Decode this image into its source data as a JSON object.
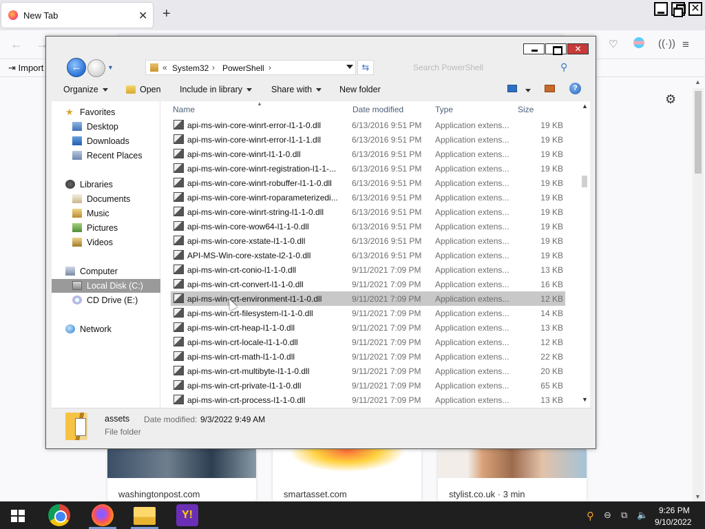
{
  "browser": {
    "tab_title": "New Tab",
    "tab_close": "✕",
    "new_tab": "+",
    "window_close": "✕",
    "import_bookmarks": "Import",
    "settings_icon": "gear-icon",
    "stories": [
      {
        "source": "washingtonpost.com"
      },
      {
        "source": "smartasset.com"
      },
      {
        "source": "stylist.co.uk · 3 min"
      }
    ]
  },
  "explorer": {
    "close_label": "✕",
    "address": {
      "overflow": "«",
      "crumbs": [
        "System32",
        "PowerShell"
      ],
      "separator": "›"
    },
    "search_placeholder": "Search PowerShell",
    "commands": {
      "organize": "Organize",
      "open": "Open",
      "include": "Include in library",
      "share": "Share with",
      "new_folder": "New folder"
    },
    "nav": {
      "favorites": "Favorites",
      "desktop": "Desktop",
      "downloads": "Downloads",
      "recent": "Recent Places",
      "libraries": "Libraries",
      "documents": "Documents",
      "music": "Music",
      "pictures": "Pictures",
      "videos": "Videos",
      "computer": "Computer",
      "local_disk": "Local Disk (C:)",
      "cd_drive": "CD Drive (E:)",
      "network": "Network"
    },
    "columns": {
      "name": "Name",
      "date": "Date modified",
      "type": "Type",
      "size": "Size"
    },
    "files": [
      {
        "name": "api-ms-win-core-winrt-error-l1-1-0.dll",
        "date": "6/13/2016 9:51 PM",
        "type": "Application extens...",
        "size": "19 KB"
      },
      {
        "name": "api-ms-win-core-winrt-error-l1-1-1.dll",
        "date": "6/13/2016 9:51 PM",
        "type": "Application extens...",
        "size": "19 KB"
      },
      {
        "name": "api-ms-win-core-winrt-l1-1-0.dll",
        "date": "6/13/2016 9:51 PM",
        "type": "Application extens...",
        "size": "19 KB"
      },
      {
        "name": "api-ms-win-core-winrt-registration-l1-1-...",
        "date": "6/13/2016 9:51 PM",
        "type": "Application extens...",
        "size": "19 KB"
      },
      {
        "name": "api-ms-win-core-winrt-robuffer-l1-1-0.dll",
        "date": "6/13/2016 9:51 PM",
        "type": "Application extens...",
        "size": "19 KB"
      },
      {
        "name": "api-ms-win-core-winrt-roparameterizedi...",
        "date": "6/13/2016 9:51 PM",
        "type": "Application extens...",
        "size": "19 KB"
      },
      {
        "name": "api-ms-win-core-winrt-string-l1-1-0.dll",
        "date": "6/13/2016 9:51 PM",
        "type": "Application extens...",
        "size": "19 KB"
      },
      {
        "name": "api-ms-win-core-wow64-l1-1-0.dll",
        "date": "6/13/2016 9:51 PM",
        "type": "Application extens...",
        "size": "19 KB"
      },
      {
        "name": "api-ms-win-core-xstate-l1-1-0.dll",
        "date": "6/13/2016 9:51 PM",
        "type": "Application extens...",
        "size": "19 KB"
      },
      {
        "name": "API-MS-Win-core-xstate-l2-1-0.dll",
        "date": "6/13/2016 9:51 PM",
        "type": "Application extens...",
        "size": "19 KB"
      },
      {
        "name": "api-ms-win-crt-conio-l1-1-0.dll",
        "date": "9/11/2021 7:09 PM",
        "type": "Application extens...",
        "size": "13 KB"
      },
      {
        "name": "api-ms-win-crt-convert-l1-1-0.dll",
        "date": "9/11/2021 7:09 PM",
        "type": "Application extens...",
        "size": "16 KB"
      },
      {
        "name": "api-ms-win-crt-environment-l1-1-0.dll",
        "date": "9/11/2021 7:09 PM",
        "type": "Application extens...",
        "size": "12 KB"
      },
      {
        "name": "api-ms-win-crt-filesystem-l1-1-0.dll",
        "date": "9/11/2021 7:09 PM",
        "type": "Application extens...",
        "size": "14 KB"
      },
      {
        "name": "api-ms-win-crt-heap-l1-1-0.dll",
        "date": "9/11/2021 7:09 PM",
        "type": "Application extens...",
        "size": "13 KB"
      },
      {
        "name": "api-ms-win-crt-locale-l1-1-0.dll",
        "date": "9/11/2021 7:09 PM",
        "type": "Application extens...",
        "size": "12 KB"
      },
      {
        "name": "api-ms-win-crt-math-l1-1-0.dll",
        "date": "9/11/2021 7:09 PM",
        "type": "Application extens...",
        "size": "22 KB"
      },
      {
        "name": "api-ms-win-crt-multibyte-l1-1-0.dll",
        "date": "9/11/2021 7:09 PM",
        "type": "Application extens...",
        "size": "20 KB"
      },
      {
        "name": "api-ms-win-crt-private-l1-1-0.dll",
        "date": "9/11/2021 7:09 PM",
        "type": "Application extens...",
        "size": "65 KB"
      },
      {
        "name": "api-ms-win-crt-process-l1-1-0.dll",
        "date": "9/11/2021 7:09 PM",
        "type": "Application extens...",
        "size": "13 KB"
      }
    ],
    "selected_file": "api-ms-win-crt-environment-l1-1-0.dll",
    "details": {
      "name": "assets",
      "modified_label": "Date modified:",
      "modified_value": "9/3/2022 9:49 AM",
      "kind": "File folder"
    }
  },
  "taskbar": {
    "apps": [
      "chrome-icon",
      "firefox-icon",
      "file-explorer-icon",
      "yahoo-messenger-icon"
    ],
    "yahoo_glyph": "Y!",
    "time": "9:26 PM",
    "date": "9/10/2022"
  },
  "colors": {
    "selection": "#c8c8c8",
    "nav_selected": "#9a9a9a",
    "taskbar": "#1f1f1f",
    "close_red": "#c83a3a"
  }
}
